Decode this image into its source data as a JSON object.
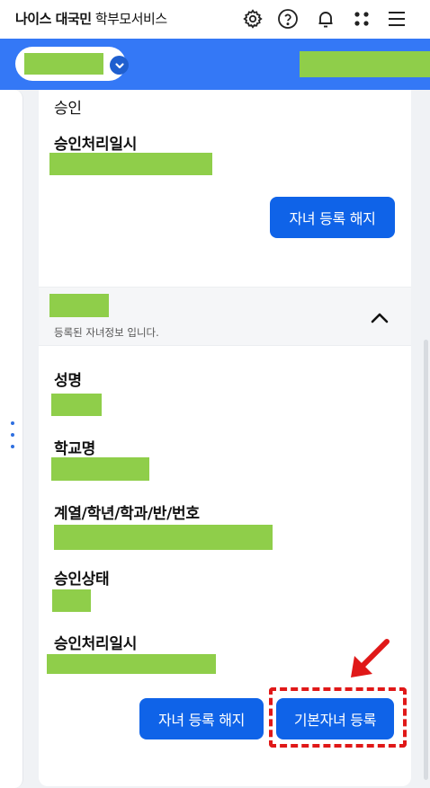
{
  "header": {
    "brand_bold": "나이스 대국민",
    "brand_light": "학부모서비스",
    "icons": [
      "gear-icon",
      "help-icon",
      "bell-icon",
      "apps-icon",
      "menu-icon"
    ]
  },
  "child_selector": {
    "icon": "chevron-down-icon"
  },
  "top_record": {
    "approval_status_label": "승인",
    "approval_date_label": "승인처리일시",
    "unregister_button": "자녀 등록 해지"
  },
  "child_section": {
    "description": "등록된 자녀정보 입니다.",
    "toggle_icon": "chevron-up-icon",
    "fields": {
      "name": "성명",
      "school": "학교명",
      "class_info": "계열/학년/학과/반/번호",
      "approval_status": "승인상태",
      "approval_date": "승인처리일시"
    },
    "unregister_button": "자녀 등록 해지",
    "default_child_button": "기본자녀 등록"
  },
  "colors": {
    "primary": "#3478f6",
    "button": "#0f63e8",
    "redaction": "#8fce4a",
    "annotation": "#e01818"
  }
}
